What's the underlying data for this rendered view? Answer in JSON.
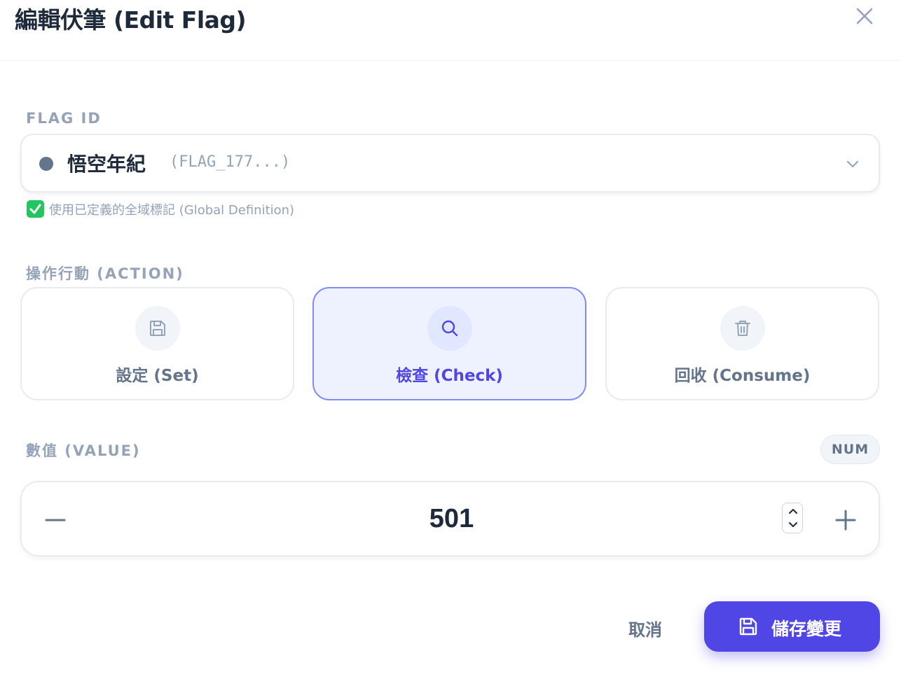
{
  "dialog": {
    "title": "編輯伏筆 (Edit Flag)",
    "close_icon": "close-icon"
  },
  "flag_id": {
    "label": "FLAG ID",
    "selected_name": "悟空年紀",
    "selected_code": "(FLAG_177...)",
    "dot_color": "#64748b",
    "hint": "使用已定義的全域標記 (Global Definition)",
    "hint_icon": "check-mark-icon",
    "hint_icon_color": "#22c55e"
  },
  "action": {
    "label": "操作行動 (ACTION)",
    "options": [
      {
        "label": "設定 (Set)",
        "icon": "save-icon",
        "selected": false
      },
      {
        "label": "檢查 (Check)",
        "icon": "search-icon",
        "selected": true
      },
      {
        "label": "回收 (Consume)",
        "icon": "trash-icon",
        "selected": false
      }
    ],
    "accent": "#4f46e5"
  },
  "value": {
    "label": "數值 (VALUE)",
    "type_badge": "NUM",
    "current": "501"
  },
  "footer": {
    "cancel_label": "取消",
    "save_label": "儲存變更",
    "save_color": "#4f46e5"
  }
}
